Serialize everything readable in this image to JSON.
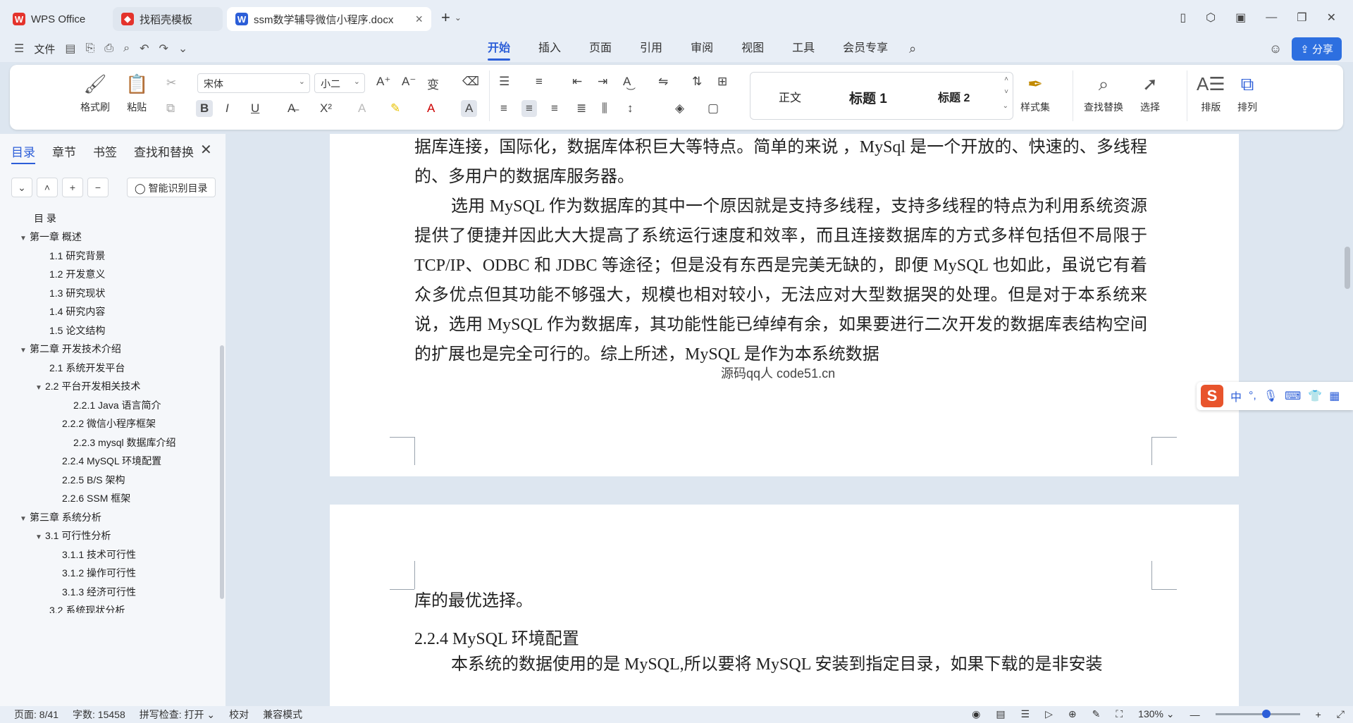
{
  "titlebar": {
    "tabs": [
      {
        "label": "WPS Office"
      },
      {
        "label": "找稻壳模板"
      },
      {
        "label": "ssm数学辅导微信小程序.docx"
      }
    ]
  },
  "menubar": {
    "file_label": "文件",
    "menus": [
      "开始",
      "插入",
      "页面",
      "引用",
      "审阅",
      "视图",
      "工具",
      "会员专享"
    ],
    "share_label": "分享"
  },
  "ribbon": {
    "format_painter": "格式刷",
    "paste": "粘贴",
    "font_name": "宋体",
    "font_size": "小二",
    "styles": [
      "正文",
      "标题 1",
      "标题 2"
    ],
    "style_set": "样式集",
    "find_replace": "查找替换",
    "select": "选择",
    "layout": "排版",
    "arrange": "排列"
  },
  "nav": {
    "tabs": [
      "目录",
      "章节",
      "书签",
      "查找和替换"
    ],
    "smart_btn": "智能识别目录",
    "toc": [
      {
        "label": "目  录"
      },
      {
        "label": "第一章 概述"
      },
      {
        "label": "1.1 研究背景"
      },
      {
        "label": "1.2 开发意义"
      },
      {
        "label": "1.3 研究现状"
      },
      {
        "label": "1.4 研究内容"
      },
      {
        "label": "1.5 论文结构"
      },
      {
        "label": "第二章 开发技术介绍"
      },
      {
        "label": "2.1 系统开发平台"
      },
      {
        "label": "2.2 平台开发相关技术"
      },
      {
        "label": "2.2.1   Java 语言简介"
      },
      {
        "label": "2.2.2   微信小程序框架"
      },
      {
        "label": "2.2.3   mysql 数据库介绍"
      },
      {
        "label": "2.2.4   MySQL 环境配置"
      },
      {
        "label": "2.2.5   B/S 架构"
      },
      {
        "label": "2.2.6   SSM 框架"
      },
      {
        "label": "第三章 系统分析"
      },
      {
        "label": "3.1 可行性分析"
      },
      {
        "label": "3.1.1 技术可行性"
      },
      {
        "label": "3.1.2 操作可行性"
      },
      {
        "label": "3.1.3 经济可行性"
      },
      {
        "label": "3.2 系统现状分析"
      }
    ]
  },
  "document": {
    "page1_para1": "据库连接，国际化，数据库体积巨大等特点。简单的来说 ，MySql 是一个开放的、快速的、多线程的、多用户的数据库服务器。",
    "page1_para2": "选用 MySQL 作为数据库的其中一个原因就是支持多线程，支持多线程的特点为利用系统资源提供了便捷并因此大大提高了系统运行速度和效率，而且连接数据库的方式多样包括但不局限于 TCP/IP、ODBC 和 JDBC 等途径；但是没有东西是完美无缺的，即便 MySQL 也如此，虽说它有着众多优点但其功能不够强大，规模也相对较小，无法应对大型数据哭的处理。但是对于本系统来说，选用 MySQL 作为数据库，其功能性能已绰绰有余，如果要进行二次开发的数据库表结构空间的扩展也是完全可行的。综上所述，MySQL 是作为本系统数据",
    "footer_note": "源码qq人 code51.cn",
    "page2_para1": "库的最优选择。",
    "page2_heading": "2.2.4    MySQL 环境配置",
    "page2_para2": "本系统的数据使用的是 MySQL,所以要将 MySQL 安装到指定目录，如果下载的是非安装"
  },
  "ime": {
    "mode": "中"
  },
  "watermark": "code51.cn",
  "statusbar": {
    "page": "页面: 8/41",
    "words": "字数: 15458",
    "spell": "拼写检查: 打开",
    "proof": "校对",
    "compat": "兼容模式",
    "zoom": "130%"
  }
}
